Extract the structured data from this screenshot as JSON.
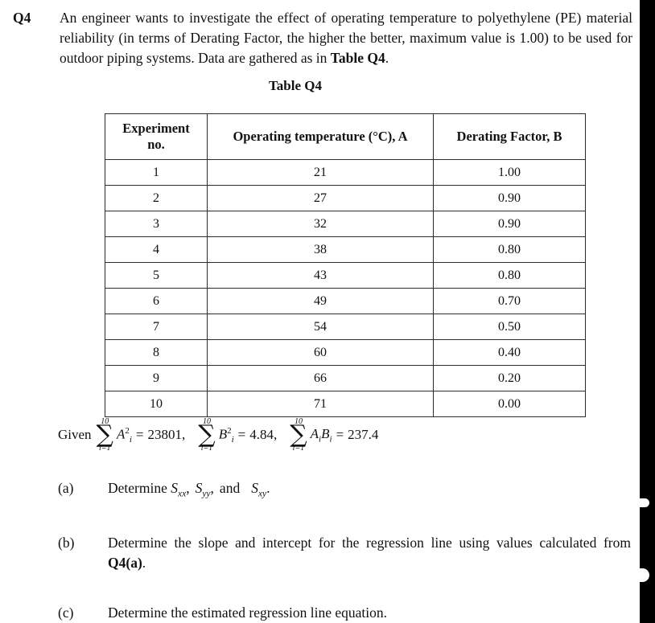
{
  "question": {
    "label": "Q4",
    "text_part1": "An engineer wants to investigate the effect of operating temperature to polyethylene (PE) material reliability (in terms of Derating Factor, the higher the better, maximum value is 1.00) to be used for outdoor piping systems. Data are gathered as in ",
    "text_bold": "Table Q4",
    "text_part2": "."
  },
  "table": {
    "caption": "Table Q4",
    "headers": {
      "col1_line1": "Experiment",
      "col1_line2": "no.",
      "col2": "Operating temperature (°C), A",
      "col3": "Derating Factor, B"
    },
    "rows": [
      {
        "no": "1",
        "temperature": "21",
        "derating": "1.00"
      },
      {
        "no": "2",
        "temperature": "27",
        "derating": "0.90"
      },
      {
        "no": "3",
        "temperature": "32",
        "derating": "0.90"
      },
      {
        "no": "4",
        "temperature": "38",
        "derating": "0.80"
      },
      {
        "no": "5",
        "temperature": "43",
        "derating": "0.80"
      },
      {
        "no": "6",
        "temperature": "49",
        "derating": "0.70"
      },
      {
        "no": "7",
        "temperature": "54",
        "derating": "0.50"
      },
      {
        "no": "8",
        "temperature": "60",
        "derating": "0.40"
      },
      {
        "no": "9",
        "temperature": "66",
        "derating": "0.20"
      },
      {
        "no": "10",
        "temperature": "71",
        "derating": "0.00"
      }
    ]
  },
  "given": {
    "word": "Given",
    "sum1": {
      "upper": "10",
      "lower": "i=1",
      "base": "A",
      "sub": "i",
      "sup": "2",
      "equals": "=",
      "value": "23801",
      "trailing": ","
    },
    "sum2": {
      "upper": "10",
      "lower": "i=1",
      "base": "B",
      "sub": "i",
      "sup": "2",
      "equals": "=",
      "value": "4.84",
      "trailing": ","
    },
    "sum3": {
      "upper": "10",
      "lower": "i=1",
      "base1": "A",
      "sub1": "i",
      "base2": "B",
      "sub2": "i",
      "equals": "=",
      "value": "237.4",
      "trailing": ""
    },
    "sigma": "∑"
  },
  "parts": {
    "a": {
      "letter": "(a)",
      "text_lead": "Determine ",
      "s1_base": "S",
      "s1_sub": "xx",
      "sep1": ",",
      "s2_base": "S",
      "s2_sub": "yy",
      "sep2": ",",
      "conj": "and",
      "s3_base": "S",
      "s3_sub": "xy",
      "period": "."
    },
    "b": {
      "letter": "(b)",
      "text_part1": "Determine the slope and intercept for the regression line using values calculated from ",
      "text_bold": "Q4(a)",
      "text_part2": "."
    },
    "c": {
      "letter": "(c)",
      "text": "Determine the estimated regression line equation."
    }
  },
  "colors": {
    "text": "#111111",
    "border": "#2b2b2b",
    "page_background": "#ffffff",
    "scan_edge": "#000000"
  }
}
